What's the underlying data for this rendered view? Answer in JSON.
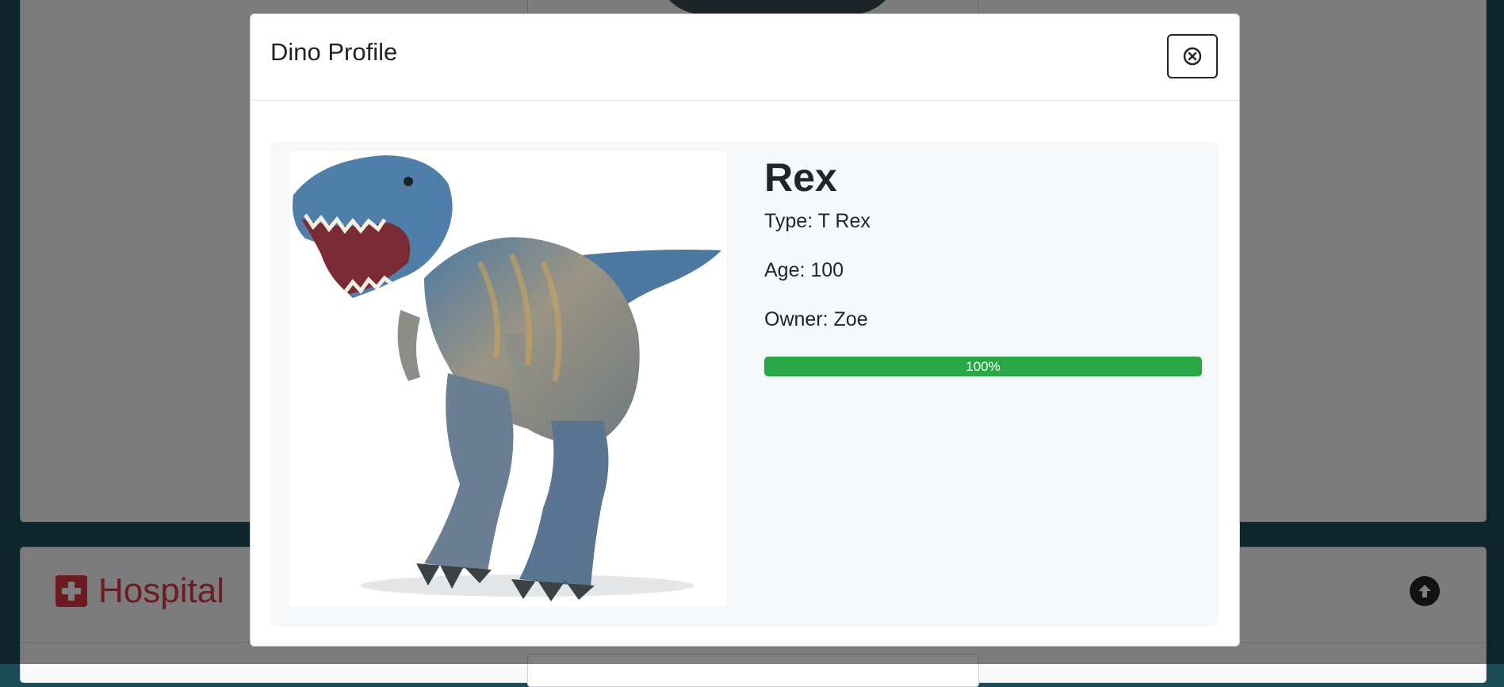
{
  "background": {
    "section_title": "Hospital"
  },
  "modal": {
    "title": "Dino Profile",
    "close_icon": "close-circle-icon",
    "dino": {
      "name": "Rex",
      "type_line": "Type: T Rex",
      "age_line": "Age: 100",
      "owner_line": "Owner: Zoe",
      "progress": 100,
      "progress_label": "100%",
      "image": "t-rex-toy-photo"
    }
  },
  "colors": {
    "accent_green": "#28a745",
    "hospital_red": "#dc3545",
    "page_teal": "#1b4b57"
  }
}
